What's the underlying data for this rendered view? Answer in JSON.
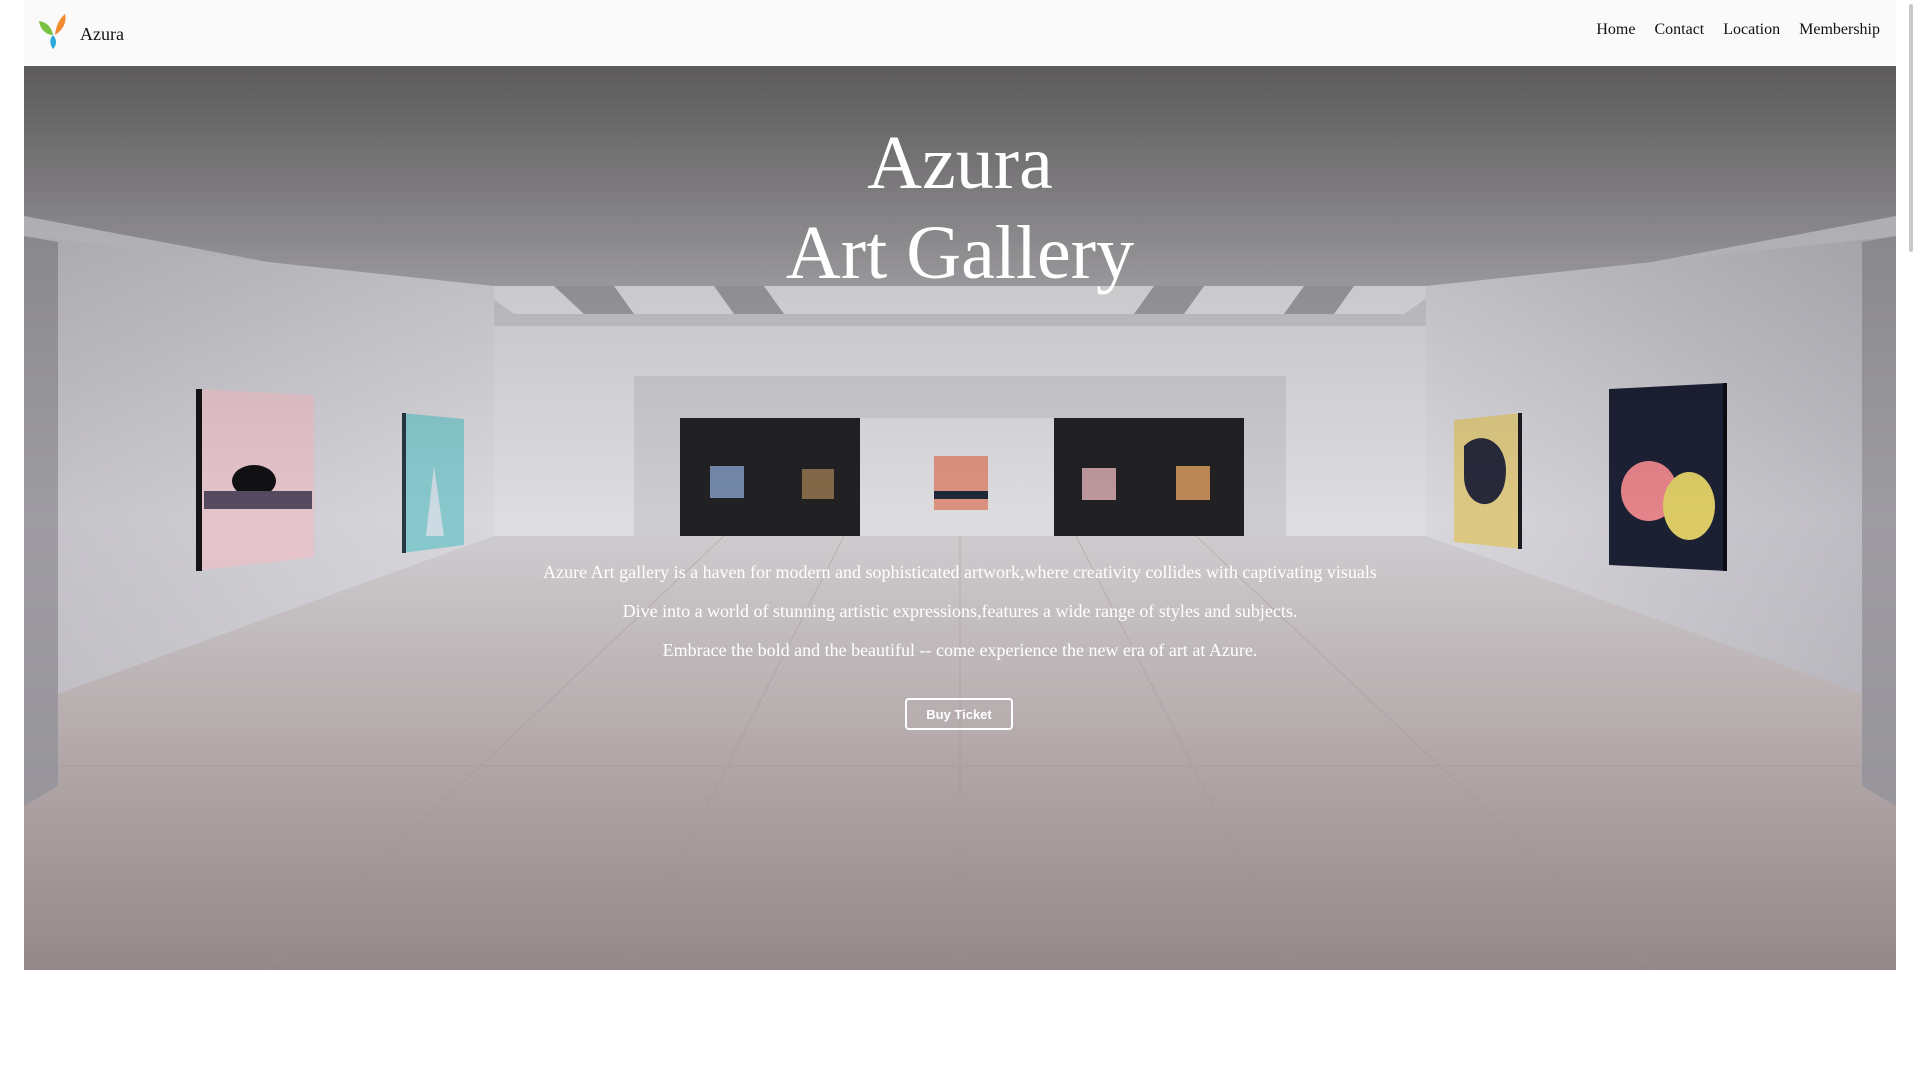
{
  "header": {
    "brand_name": "Azura",
    "logo_icon": "leaf-logo-icon",
    "nav": [
      {
        "label": "Home"
      },
      {
        "label": "Contact"
      },
      {
        "label": "Location"
      },
      {
        "label": "Membership"
      }
    ]
  },
  "hero": {
    "title_line1": "Azura",
    "title_line2": "Art Gallery",
    "paragraphs": [
      "Azure Art gallery is a haven for modern and sophisticated artwork,where creativity collides with captivating visuals",
      "Dive into a world of stunning artistic expressions,features a wide range of styles and subjects.",
      "Embrace the bold and the beautiful -- come experience the new era of art at Azure."
    ],
    "cta_label": "Buy Ticket",
    "background_image": "gallery-interior-image"
  },
  "colors": {
    "navbar_bg": "#fafafa",
    "hero_text": "#ffffff",
    "logo_green": "#7cc242",
    "logo_orange": "#f28b30",
    "logo_blue": "#2aa8d8"
  }
}
